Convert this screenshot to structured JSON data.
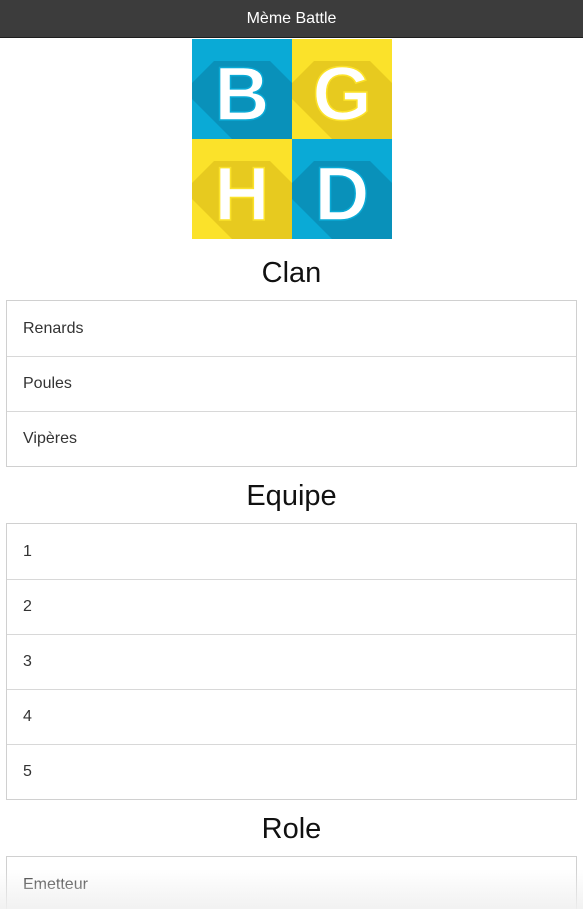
{
  "window": {
    "title": "Mème Battle"
  },
  "logo": {
    "letters": [
      "B",
      "G",
      "H",
      "D"
    ],
    "colors": {
      "blue": "#0aaad6",
      "blue_shadow": "#0988b0",
      "yellow": "#fbe22a",
      "yellow_shadow": "#e3c61d"
    }
  },
  "sections": {
    "clan": {
      "title": "Clan",
      "items": [
        "Renards",
        "Poules",
        "Vipères"
      ]
    },
    "equipe": {
      "title": "Equipe",
      "items": [
        "1",
        "2",
        "3",
        "4",
        "5"
      ]
    },
    "role": {
      "title": "Role",
      "items": [
        "Emetteur"
      ]
    }
  }
}
